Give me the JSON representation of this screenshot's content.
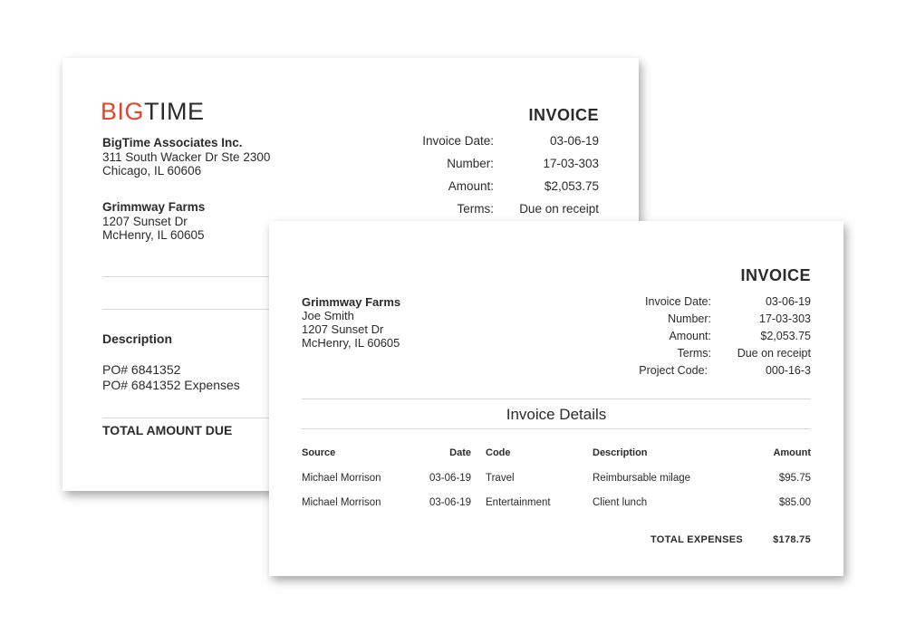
{
  "back_invoice": {
    "logo": {
      "part1": "BIG",
      "part2": "TIME"
    },
    "company": {
      "name": "BigTime Associates Inc.",
      "line1": "311 South Wacker Dr Ste 2300",
      "line2": "Chicago, IL 60606"
    },
    "client": {
      "name": "Grimmway Farms",
      "line1": "1207 Sunset Dr",
      "line2": "McHenry, IL 60605"
    },
    "title": "INVOICE",
    "fields": [
      {
        "label": "Invoice Date:",
        "value": "03-06-19"
      },
      {
        "label": "Number:",
        "value": "17-03-303"
      },
      {
        "label": "Amount:",
        "value": "$2,053.75"
      },
      {
        "label": "Terms:",
        "value": "Due on receipt"
      }
    ],
    "description_heading": "Description",
    "description_lines": [
      "PO# 6841352",
      "PO# 6841352 Expenses"
    ],
    "total_label": "TOTAL AMOUNT DUE"
  },
  "front_invoice": {
    "title": "INVOICE",
    "client": {
      "name": "Grimmway Farms",
      "contact": "Joe Smith",
      "line1": "1207 Sunset Dr",
      "line2": "McHenry, IL 60605"
    },
    "fields": [
      {
        "label": "Invoice Date:",
        "value": "03-06-19"
      },
      {
        "label": "Number:",
        "value": "17-03-303"
      },
      {
        "label": "Amount:",
        "value": "$2,053.75"
      },
      {
        "label": "Terms:",
        "value": "Due on receipt"
      },
      {
        "label": "Project Code:",
        "value": "000-16-3"
      }
    ],
    "details_title": "Invoice Details",
    "columns": {
      "source": "Source",
      "date": "Date",
      "code": "Code",
      "description": "Description",
      "amount": "Amount"
    },
    "rows": [
      {
        "source": "Michael Morrison",
        "date": "03-06-19",
        "code": "Travel",
        "description": "Reimbursable milage",
        "amount": "$95.75"
      },
      {
        "source": "Michael Morrison",
        "date": "03-06-19",
        "code": "Entertainment",
        "description": "Client lunch",
        "amount": "$85.00"
      }
    ],
    "total_label": "TOTAL EXPENSES",
    "total_value": "$178.75"
  }
}
